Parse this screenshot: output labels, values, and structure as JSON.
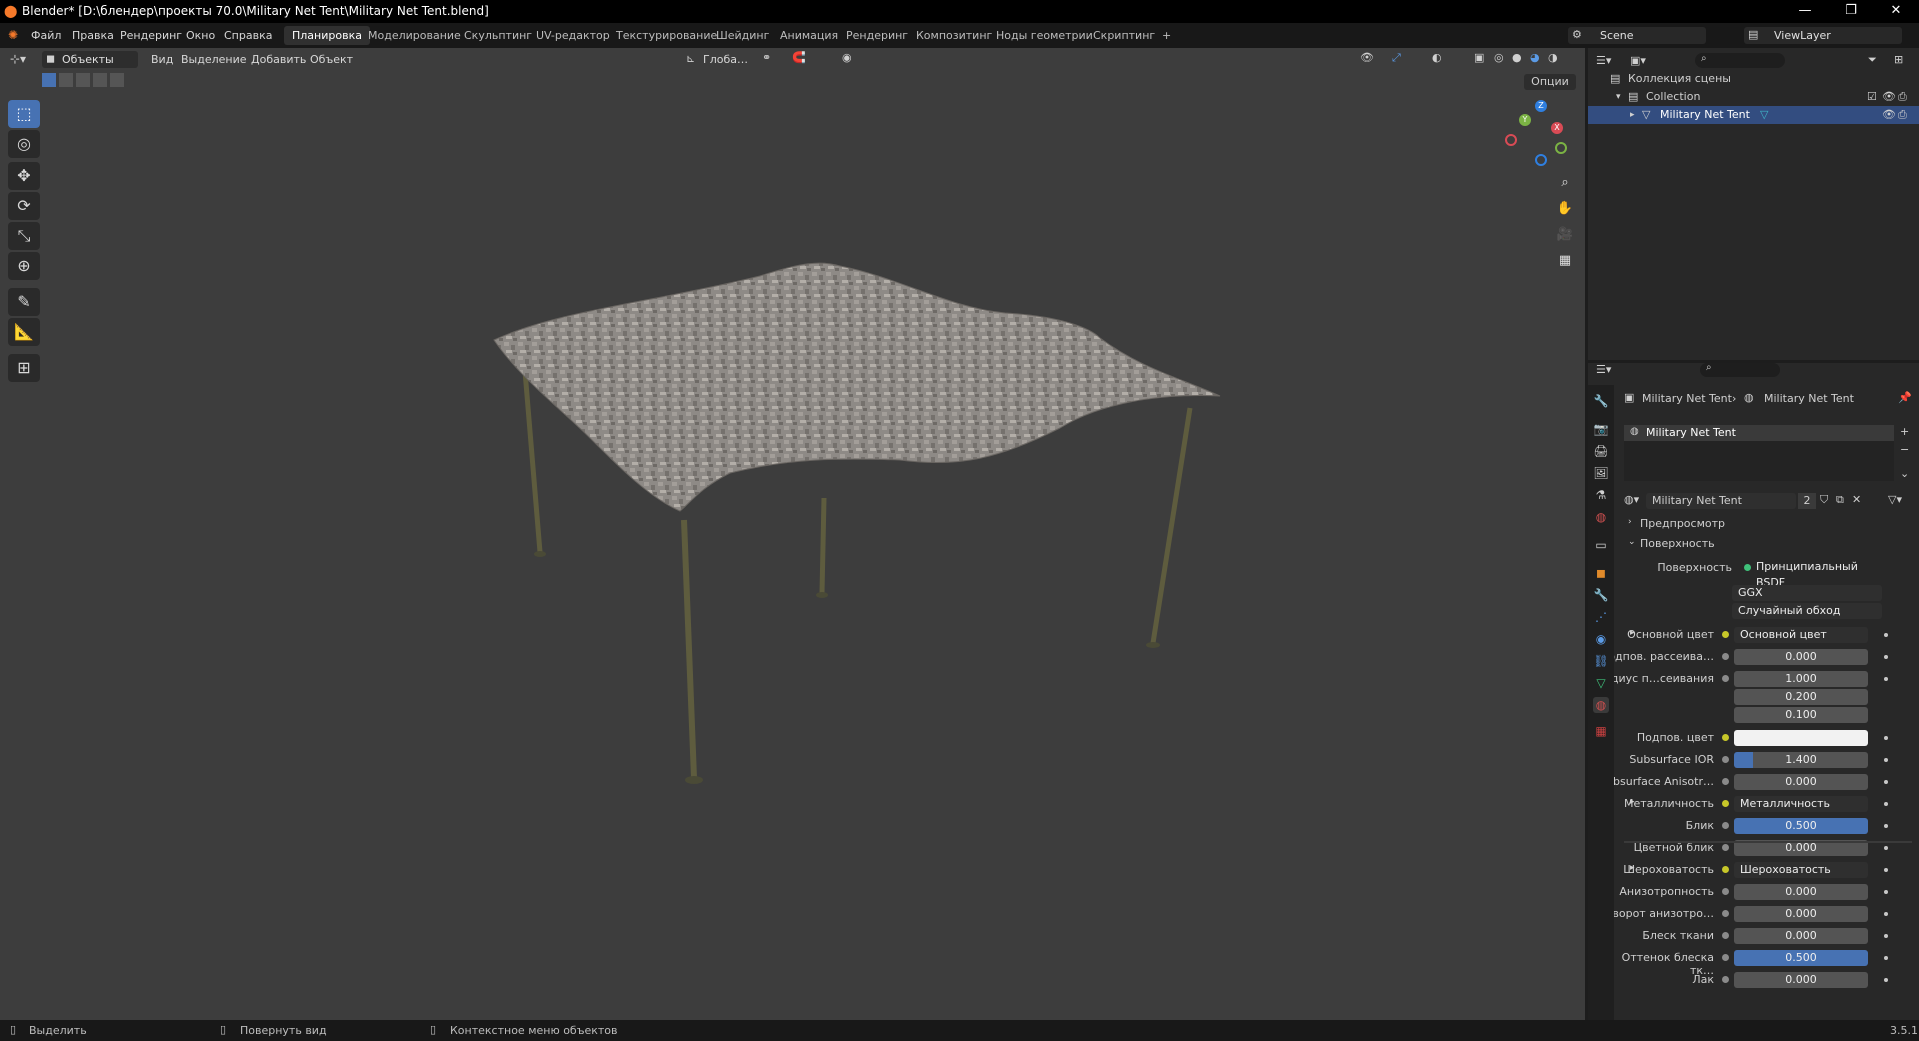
{
  "titlebar": {
    "title": "Blender* [D:\\блендер\\проекты 70.0\\Military Net Tent\\Military Net Tent.blend]",
    "minimize": "—",
    "maximize": "❐",
    "close": "✕"
  },
  "menu": [
    "Файл",
    "Правка",
    "Рендеринг",
    "Окно",
    "Справка"
  ],
  "workspaces": [
    "Планировка",
    "Моделирование",
    "Скульптинг",
    "UV-редактор",
    "Текстурирование",
    "Шейдинг",
    "Анимация",
    "Рендеринг",
    "Композитинг",
    "Ноды геометрии",
    "Скриптинг"
  ],
  "active_workspace": "Планировка",
  "add_workspace": "+",
  "scene": {
    "label": "Scene",
    "viewlayer": "ViewLayer"
  },
  "viewport_header": {
    "mode": "Объекты",
    "menus": [
      "Вид",
      "Выделение",
      "Добавить",
      "Объект"
    ],
    "orientation": "Глоба…",
    "options": "Опции"
  },
  "gizmo": {
    "x": "X",
    "y": "Y",
    "z": "Z"
  },
  "outliner": {
    "scene_collection": "Коллекция сцены",
    "collection": "Collection",
    "object": "Military Net Tent"
  },
  "properties": {
    "breadcrumb_object": "Military Net Tent",
    "breadcrumb_material": "Military Net Tent",
    "slot_name": "Military Net Tent",
    "material_name": "Military Net Tent",
    "users": "2",
    "panels": {
      "preview": "Предпросмотр",
      "surface": "Поверхность"
    },
    "surface_label": "Поверхность",
    "surface_value": "Принципиальный BSDF",
    "distribution": "GGX",
    "subsurface_method": "Случайный обход",
    "rows": [
      {
        "label": "Основной цвет",
        "value": "Основной цвет",
        "type": "link"
      },
      {
        "label": "Подпов. рассеива…",
        "value": "0.000",
        "type": "num"
      },
      {
        "label": "Радиус п…сеивания",
        "value": "1.000",
        "type": "num"
      },
      {
        "label": "",
        "value": "0.200",
        "type": "num"
      },
      {
        "label": "",
        "value": "0.100",
        "type": "num"
      },
      {
        "label": "Подпов. цвет",
        "value": "",
        "type": "color"
      },
      {
        "label": "Subsurface IOR",
        "value": "1.400",
        "type": "num",
        "fill": 0.14
      },
      {
        "label": "Subsurface Anisotr…",
        "value": "0.000",
        "type": "num"
      },
      {
        "label": "Металличность",
        "value": "Металличность",
        "type": "link"
      },
      {
        "label": "Блик",
        "value": "0.500",
        "type": "num",
        "fill": 1.0
      },
      {
        "label": "Цветной блик",
        "value": "0.000",
        "type": "num"
      },
      {
        "label": "Шероховатость",
        "value": "Шероховатость",
        "type": "link"
      },
      {
        "label": "Анизотропность",
        "value": "0.000",
        "type": "num"
      },
      {
        "label": "Поворот анизотро…",
        "value": "0.000",
        "type": "num"
      },
      {
        "label": "Блеск ткани",
        "value": "0.000",
        "type": "num"
      },
      {
        "label": "Оттенок блеска тк…",
        "value": "0.500",
        "type": "num",
        "fill": 1.0
      },
      {
        "label": "Лак",
        "value": "0.000",
        "type": "num"
      }
    ]
  },
  "statusbar": {
    "select": "Выделить",
    "rotate": "Повернуть вид",
    "context": "Контекстное меню объектов",
    "version": "3.5.1"
  },
  "colors": {
    "accent": "#4772b3",
    "bg_viewport": "#3d3d3d",
    "panel": "#282828"
  }
}
